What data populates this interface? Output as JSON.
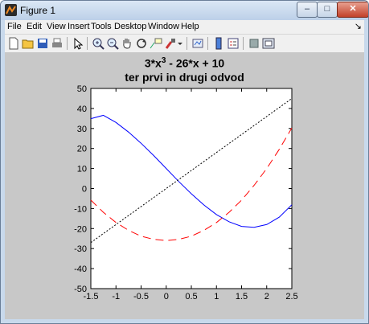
{
  "window": {
    "title": "Figure 1",
    "controls": {
      "minimize": "–",
      "maximize": "□",
      "close": "✕"
    }
  },
  "menubar": {
    "items": [
      "File",
      "Edit",
      "View",
      "Insert",
      "Tools",
      "Desktop",
      "Window",
      "Help"
    ],
    "arrow": "↘"
  },
  "toolbar": {
    "icons": [
      "new-figure-icon",
      "open-file-icon",
      "save-icon",
      "print-icon",
      "edit-plot-arrow-icon",
      "zoom-in-icon",
      "zoom-out-icon",
      "pan-hand-icon",
      "rotate-3d-icon",
      "data-cursor-icon",
      "brush-icon",
      "brush-dropdown-icon",
      "link-plot-icon",
      "colorbar-icon",
      "legend-icon",
      "hide-plot-tools-icon",
      "show-plot-tools-icon"
    ]
  },
  "colors": {
    "figure_bg": "#c8c8c8",
    "axes_bg": "#ffffff",
    "series_blue": "#0000ff",
    "series_red": "#ff0000",
    "series_black": "#000000"
  },
  "chart_data": {
    "type": "line",
    "title_line1_base": "3*x",
    "title_line1_sup": "3",
    "title_line1_rest": " - 26*x + 10",
    "title_line2": "ter prvi in drugi odvod",
    "xlim": [
      -1.5,
      2.5
    ],
    "ylim": [
      -50,
      50
    ],
    "xticks": [
      -1.5,
      -1,
      -0.5,
      0,
      0.5,
      1,
      1.5,
      2,
      2.5
    ],
    "xtick_labels": [
      "-1.5",
      "-1",
      "-0.5",
      "0",
      "0.5",
      "1",
      "1.5",
      "2",
      "2.5"
    ],
    "yticks": [
      -50,
      -40,
      -30,
      -20,
      -10,
      0,
      10,
      20,
      30,
      40,
      50
    ],
    "ytick_labels": [
      "-50",
      "-40",
      "-30",
      "-20",
      "-10",
      "0",
      "10",
      "20",
      "30",
      "40",
      "50"
    ],
    "grid": false,
    "series": [
      {
        "color": "#0000ff",
        "style": "solid",
        "x": [
          -1.5,
          -1.25,
          -1,
          -0.75,
          -0.5,
          -0.25,
          0,
          0.25,
          0.5,
          0.75,
          1,
          1.25,
          1.5,
          1.75,
          2,
          2.25,
          2.5
        ],
        "y": [
          34.9,
          36.6,
          33.0,
          28.2,
          22.6,
          16.5,
          10.0,
          3.5,
          -2.6,
          -8.2,
          -13.0,
          -16.6,
          -18.9,
          -19.4,
          -18.0,
          -14.3,
          -8.1
        ]
      },
      {
        "color": "#ff0000",
        "style": "dashed",
        "x": [
          -1.5,
          -1.25,
          -1,
          -0.75,
          -0.5,
          -0.25,
          0,
          0.25,
          0.5,
          0.75,
          1,
          1.25,
          1.5,
          1.75,
          2,
          2.25,
          2.5
        ],
        "y": [
          -5.8,
          -11.9,
          -17.0,
          -20.9,
          -23.8,
          -25.4,
          -26.0,
          -25.4,
          -23.8,
          -20.9,
          -17.0,
          -11.9,
          -5.8,
          1.6,
          10.0,
          19.6,
          30.3
        ]
      },
      {
        "color": "#000000",
        "style": "dotted",
        "x": [
          -1.5,
          2.5
        ],
        "y": [
          -27.0,
          45.0
        ]
      }
    ]
  }
}
